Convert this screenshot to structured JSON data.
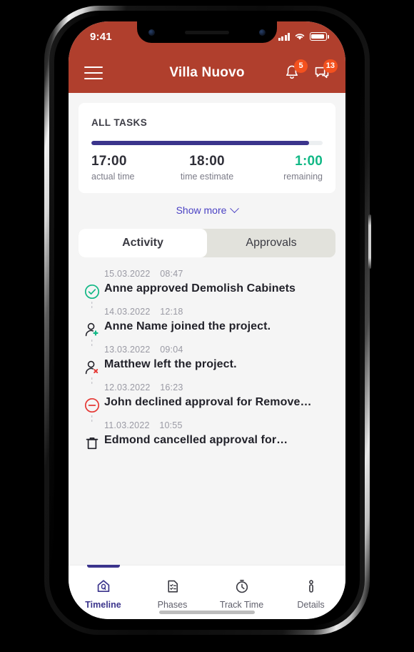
{
  "theme": {
    "header_bg": "#b03f2d",
    "accent_indigo": "#3b348c",
    "accent_link": "#4b42c4",
    "success_green": "#12b886",
    "danger_red": "#e53935",
    "badge_orange": "#f4511e"
  },
  "status_bar": {
    "time": "9:41",
    "signal_icon": "cellular-signal-icon",
    "wifi_icon": "wifi-icon",
    "battery_icon": "battery-full-icon"
  },
  "app_bar": {
    "menu_icon": "hamburger-menu-icon",
    "title": "Villa Nuovo",
    "notifications": {
      "icon": "bell-icon",
      "badge": "5"
    },
    "messages": {
      "icon": "chat-bubble-icon",
      "badge": "13"
    }
  },
  "summary_card": {
    "title": "ALL TASKS",
    "progress_percent": 94,
    "stats": [
      {
        "value": "17:00",
        "label": "actual time"
      },
      {
        "value": "18:00",
        "label": "time estimate"
      },
      {
        "value": "1:00",
        "label": "remaining"
      }
    ]
  },
  "show_more": {
    "label": "Show more",
    "icon": "chevron-down-icon"
  },
  "tabs": [
    {
      "label": "Activity",
      "active": true
    },
    {
      "label": "Approvals",
      "active": false
    }
  ],
  "activity": [
    {
      "date": "15.03.2022",
      "time": "08:47",
      "text": "Anne approved Demolish Cabinets",
      "icon": "check-circle-icon"
    },
    {
      "date": "14.03.2022",
      "time": "12:18",
      "text": "Anne Name joined the project.",
      "icon": "person-add-icon"
    },
    {
      "date": "13.03.2022",
      "time": "09:04",
      "text": "Matthew left the project.",
      "icon": "person-remove-icon"
    },
    {
      "date": "12.03.2022",
      "time": "16:23",
      "text": "John declined approval for Remove…",
      "icon": "minus-circle-icon"
    },
    {
      "date": "11.03.2022",
      "time": "10:55",
      "text": "Edmond cancelled approval for…",
      "icon": "trash-icon"
    }
  ],
  "bottom_nav": [
    {
      "label": "Timeline",
      "icon": "home-timeline-icon",
      "active": true
    },
    {
      "label": "Phases",
      "icon": "checklist-document-icon",
      "active": false
    },
    {
      "label": "Track Time",
      "icon": "stopwatch-icon",
      "active": false
    },
    {
      "label": "Details",
      "icon": "info-person-icon",
      "active": false
    }
  ]
}
